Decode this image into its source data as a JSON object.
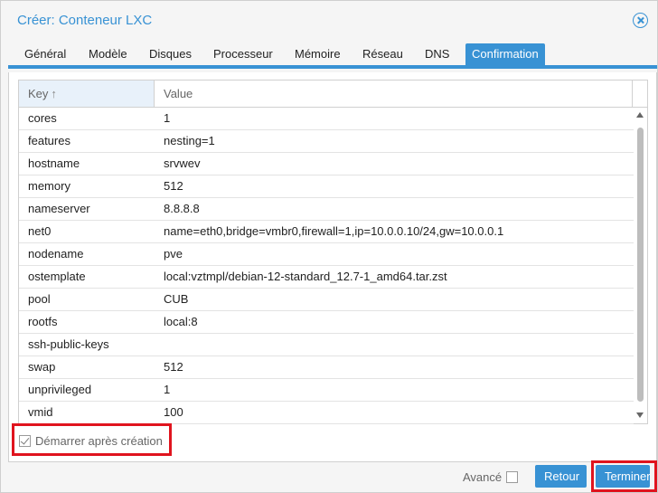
{
  "window": {
    "title": "Créer: Conteneur LXC"
  },
  "tabs": [
    {
      "label": "Général"
    },
    {
      "label": "Modèle"
    },
    {
      "label": "Disques"
    },
    {
      "label": "Processeur"
    },
    {
      "label": "Mémoire"
    },
    {
      "label": "Réseau"
    },
    {
      "label": "DNS"
    },
    {
      "label": "Confirmation",
      "active": true
    }
  ],
  "grid": {
    "columns": {
      "key": "Key",
      "value": "Value"
    },
    "rows": [
      {
        "key": "cores",
        "value": "1"
      },
      {
        "key": "features",
        "value": "nesting=1"
      },
      {
        "key": "hostname",
        "value": "srvwev"
      },
      {
        "key": "memory",
        "value": "512"
      },
      {
        "key": "nameserver",
        "value": "8.8.8.8"
      },
      {
        "key": "net0",
        "value": "name=eth0,bridge=vmbr0,firewall=1,ip=10.0.0.10/24,gw=10.0.0.1"
      },
      {
        "key": "nodename",
        "value": "pve"
      },
      {
        "key": "ostemplate",
        "value": "local:vztmpl/debian-12-standard_12.7-1_amd64.tar.zst"
      },
      {
        "key": "pool",
        "value": "CUB"
      },
      {
        "key": "rootfs",
        "value": "local:8"
      },
      {
        "key": "ssh-public-keys",
        "value": ""
      },
      {
        "key": "swap",
        "value": "512"
      },
      {
        "key": "unprivileged",
        "value": "1"
      },
      {
        "key": "vmid",
        "value": "100"
      }
    ]
  },
  "options": {
    "start_after_create": {
      "label": "Démarrer après création",
      "checked": true
    }
  },
  "footer": {
    "advanced_label": "Avancé",
    "advanced_checked": false,
    "back_label": "Retour",
    "finish_label": "Terminer"
  },
  "colors": {
    "accent": "#3892d4",
    "highlight": "#e0141e"
  }
}
